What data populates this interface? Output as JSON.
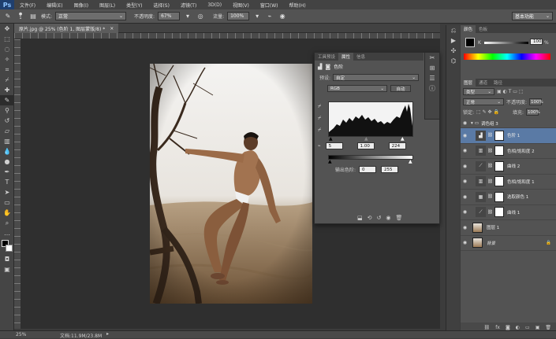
{
  "menubar": {
    "logo": "Ps",
    "items": [
      "文件(F)",
      "编辑(E)",
      "图像(I)",
      "图层(L)",
      "类型(Y)",
      "选择(S)",
      "滤镜(T)",
      "3D(D)",
      "视图(V)",
      "窗口(W)",
      "帮助(H)"
    ]
  },
  "options": {
    "size": "1",
    "mode_label": "模式:",
    "mode_value": "正常",
    "opacity_label": "不透明度:",
    "opacity_value": "67%",
    "flow_label": "流量:",
    "flow_value": "100%",
    "workspace": "基本功能"
  },
  "document_tab": {
    "title": "原片.jpg @ 25% (色阶 1, 图层蒙版/8) *",
    "close": "×"
  },
  "status": {
    "zoom": "25%",
    "doc_info": "文档:11.9M/23.8M"
  },
  "properties": {
    "tabs": [
      "工具预设",
      "属性",
      "信息"
    ],
    "title": "色阶",
    "preset_label": "预设:",
    "preset_value": "自定",
    "channel": "RGB",
    "auto_button": "自动",
    "input_black": "5",
    "input_gamma": "1.00",
    "input_white": "224",
    "output_label": "输出色阶:",
    "output_black": "0",
    "output_white": "255"
  },
  "color_panel": {
    "tabs": [
      "颜色",
      "色板"
    ],
    "k_label": "K",
    "k_value": "100",
    "k_unit": "%"
  },
  "layers_panel": {
    "tabs": [
      "图层",
      "通道",
      "路径"
    ],
    "filter_kind": "类型",
    "blend_mode": "正常",
    "opacity_label": "不透明度:",
    "opacity_value": "100%",
    "lock_label": "锁定:",
    "fill_label": "填充:",
    "fill_value": "100%",
    "group_name": "调色组 3",
    "layers": [
      {
        "name": "色阶 1",
        "selected": true
      },
      {
        "name": "色相/饱和度 2",
        "selected": false
      },
      {
        "name": "曲线 2",
        "selected": false
      },
      {
        "name": "色相/饱和度 1",
        "selected": false
      },
      {
        "name": "选取颜色 1",
        "selected": false
      },
      {
        "name": "曲线 1",
        "selected": false
      },
      {
        "name": "图层 1",
        "selected": false
      },
      {
        "name": "背景",
        "selected": false
      }
    ]
  },
  "colors": {
    "selection": "#5a7aa5",
    "panel": "#535353"
  }
}
